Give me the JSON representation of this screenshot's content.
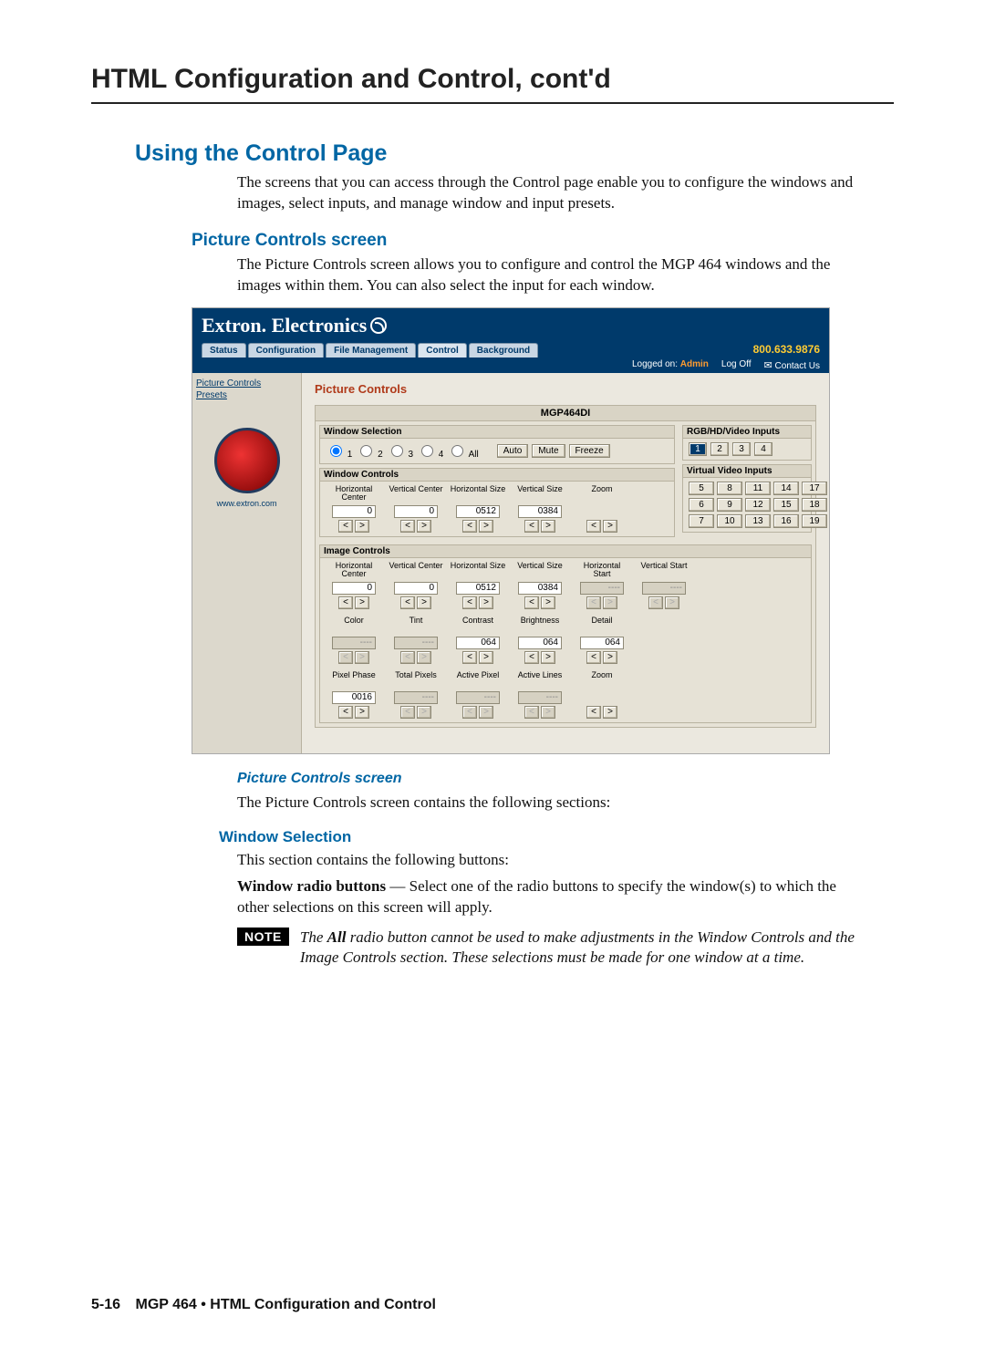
{
  "page": {
    "chapter_title": "HTML Configuration and Control, cont'd",
    "section_title": "Using the Control Page",
    "section_para": "The screens that you can access through the Control page enable you to configure the windows and images, select inputs, and manage window and input presets.",
    "subsection_title": "Picture Controls screen",
    "subsection_para": "The Picture Controls screen allows you to configure and control the MGP 464 windows and the images within them.  You can also select the input for each window.",
    "figure_caption": "Picture Controls screen",
    "after_fig_para": "The Picture Controls screen contains the following sections:",
    "ws_head": "Window Selection",
    "ws_para": "This section contains the following buttons:",
    "ws_def_runin": "Window radio buttons",
    "ws_def_rest": " — Select one of the radio buttons to specify the window(s) to which the other selections on this screen will apply.",
    "note_badge": "NOTE",
    "note_lead": "The ",
    "note_allword": "All",
    "note_rest": " radio button cannot be used to make adjustments in the Window Controls and the Image Controls section.  These selections must be made for one window at a time.",
    "footer_page": "5-16",
    "footer_text": "MGP 464 • HTML Configuration and Control"
  },
  "app": {
    "brand": "Extron. Electronics",
    "tabs": [
      "Status",
      "Configuration",
      "File Management",
      "Control",
      "Background"
    ],
    "active_tab": "Control",
    "phone": "800.633.9876",
    "metabar": {
      "logged_label": "Logged on:",
      "admin": "Admin",
      "logoff": "Log Off",
      "contact": "Contact Us"
    },
    "sidebar": {
      "links": [
        "Picture Controls",
        "Presets"
      ],
      "url": "www.extron.com"
    },
    "content_title": "Picture Controls",
    "model": "MGP464DI",
    "window_selection": {
      "legend": "Window Selection",
      "radios": [
        "1",
        "2",
        "3",
        "4",
        "All"
      ],
      "selected": "1",
      "buttons": [
        "Auto",
        "Mute",
        "Freeze"
      ]
    },
    "rgb_inputs": {
      "legend": "RGB/HD/Video Inputs",
      "items": [
        "1",
        "2",
        "3",
        "4"
      ],
      "selected": "1"
    },
    "virtual_inputs": {
      "legend": "Virtual Video Inputs",
      "items": [
        "5",
        "8",
        "11",
        "14",
        "17",
        "6",
        "9",
        "12",
        "15",
        "18",
        "7",
        "10",
        "13",
        "16",
        "19"
      ]
    },
    "window_controls": {
      "legend": "Window Controls",
      "items": [
        {
          "label": "Horizontal Center",
          "value": "0",
          "disabled": false
        },
        {
          "label": "Vertical Center",
          "value": "0",
          "disabled": false
        },
        {
          "label": "Horizontal Size",
          "value": "0512",
          "disabled": false
        },
        {
          "label": "Vertical Size",
          "value": "0384",
          "disabled": false
        },
        {
          "label": "Zoom",
          "value": "",
          "disabled": false,
          "novalue": true
        }
      ]
    },
    "image_controls": {
      "legend": "Image Controls",
      "rows": [
        [
          {
            "label": "Horizontal Center",
            "value": "0",
            "disabled": false
          },
          {
            "label": "Vertical Center",
            "value": "0",
            "disabled": false
          },
          {
            "label": "Horizontal Size",
            "value": "0512",
            "disabled": false
          },
          {
            "label": "Vertical Size",
            "value": "0384",
            "disabled": false
          },
          {
            "label": "Horizontal Start",
            "value": "----",
            "disabled": true
          },
          {
            "label": "Vertical Start",
            "value": "----",
            "disabled": true
          }
        ],
        [
          {
            "label": "Color",
            "value": "----",
            "disabled": true
          },
          {
            "label": "Tint",
            "value": "----",
            "disabled": true
          },
          {
            "label": "Contrast",
            "value": "064",
            "disabled": false
          },
          {
            "label": "Brightness",
            "value": "064",
            "disabled": false
          },
          {
            "label": "Detail",
            "value": "064",
            "disabled": false
          }
        ],
        [
          {
            "label": "Pixel Phase",
            "value": "0016",
            "disabled": false
          },
          {
            "label": "Total Pixels",
            "value": "----",
            "disabled": true
          },
          {
            "label": "Active Pixel",
            "value": "----",
            "disabled": true
          },
          {
            "label": "Active Lines",
            "value": "----",
            "disabled": true
          },
          {
            "label": "Zoom",
            "value": "",
            "disabled": false,
            "novalue": true
          }
        ]
      ]
    }
  }
}
